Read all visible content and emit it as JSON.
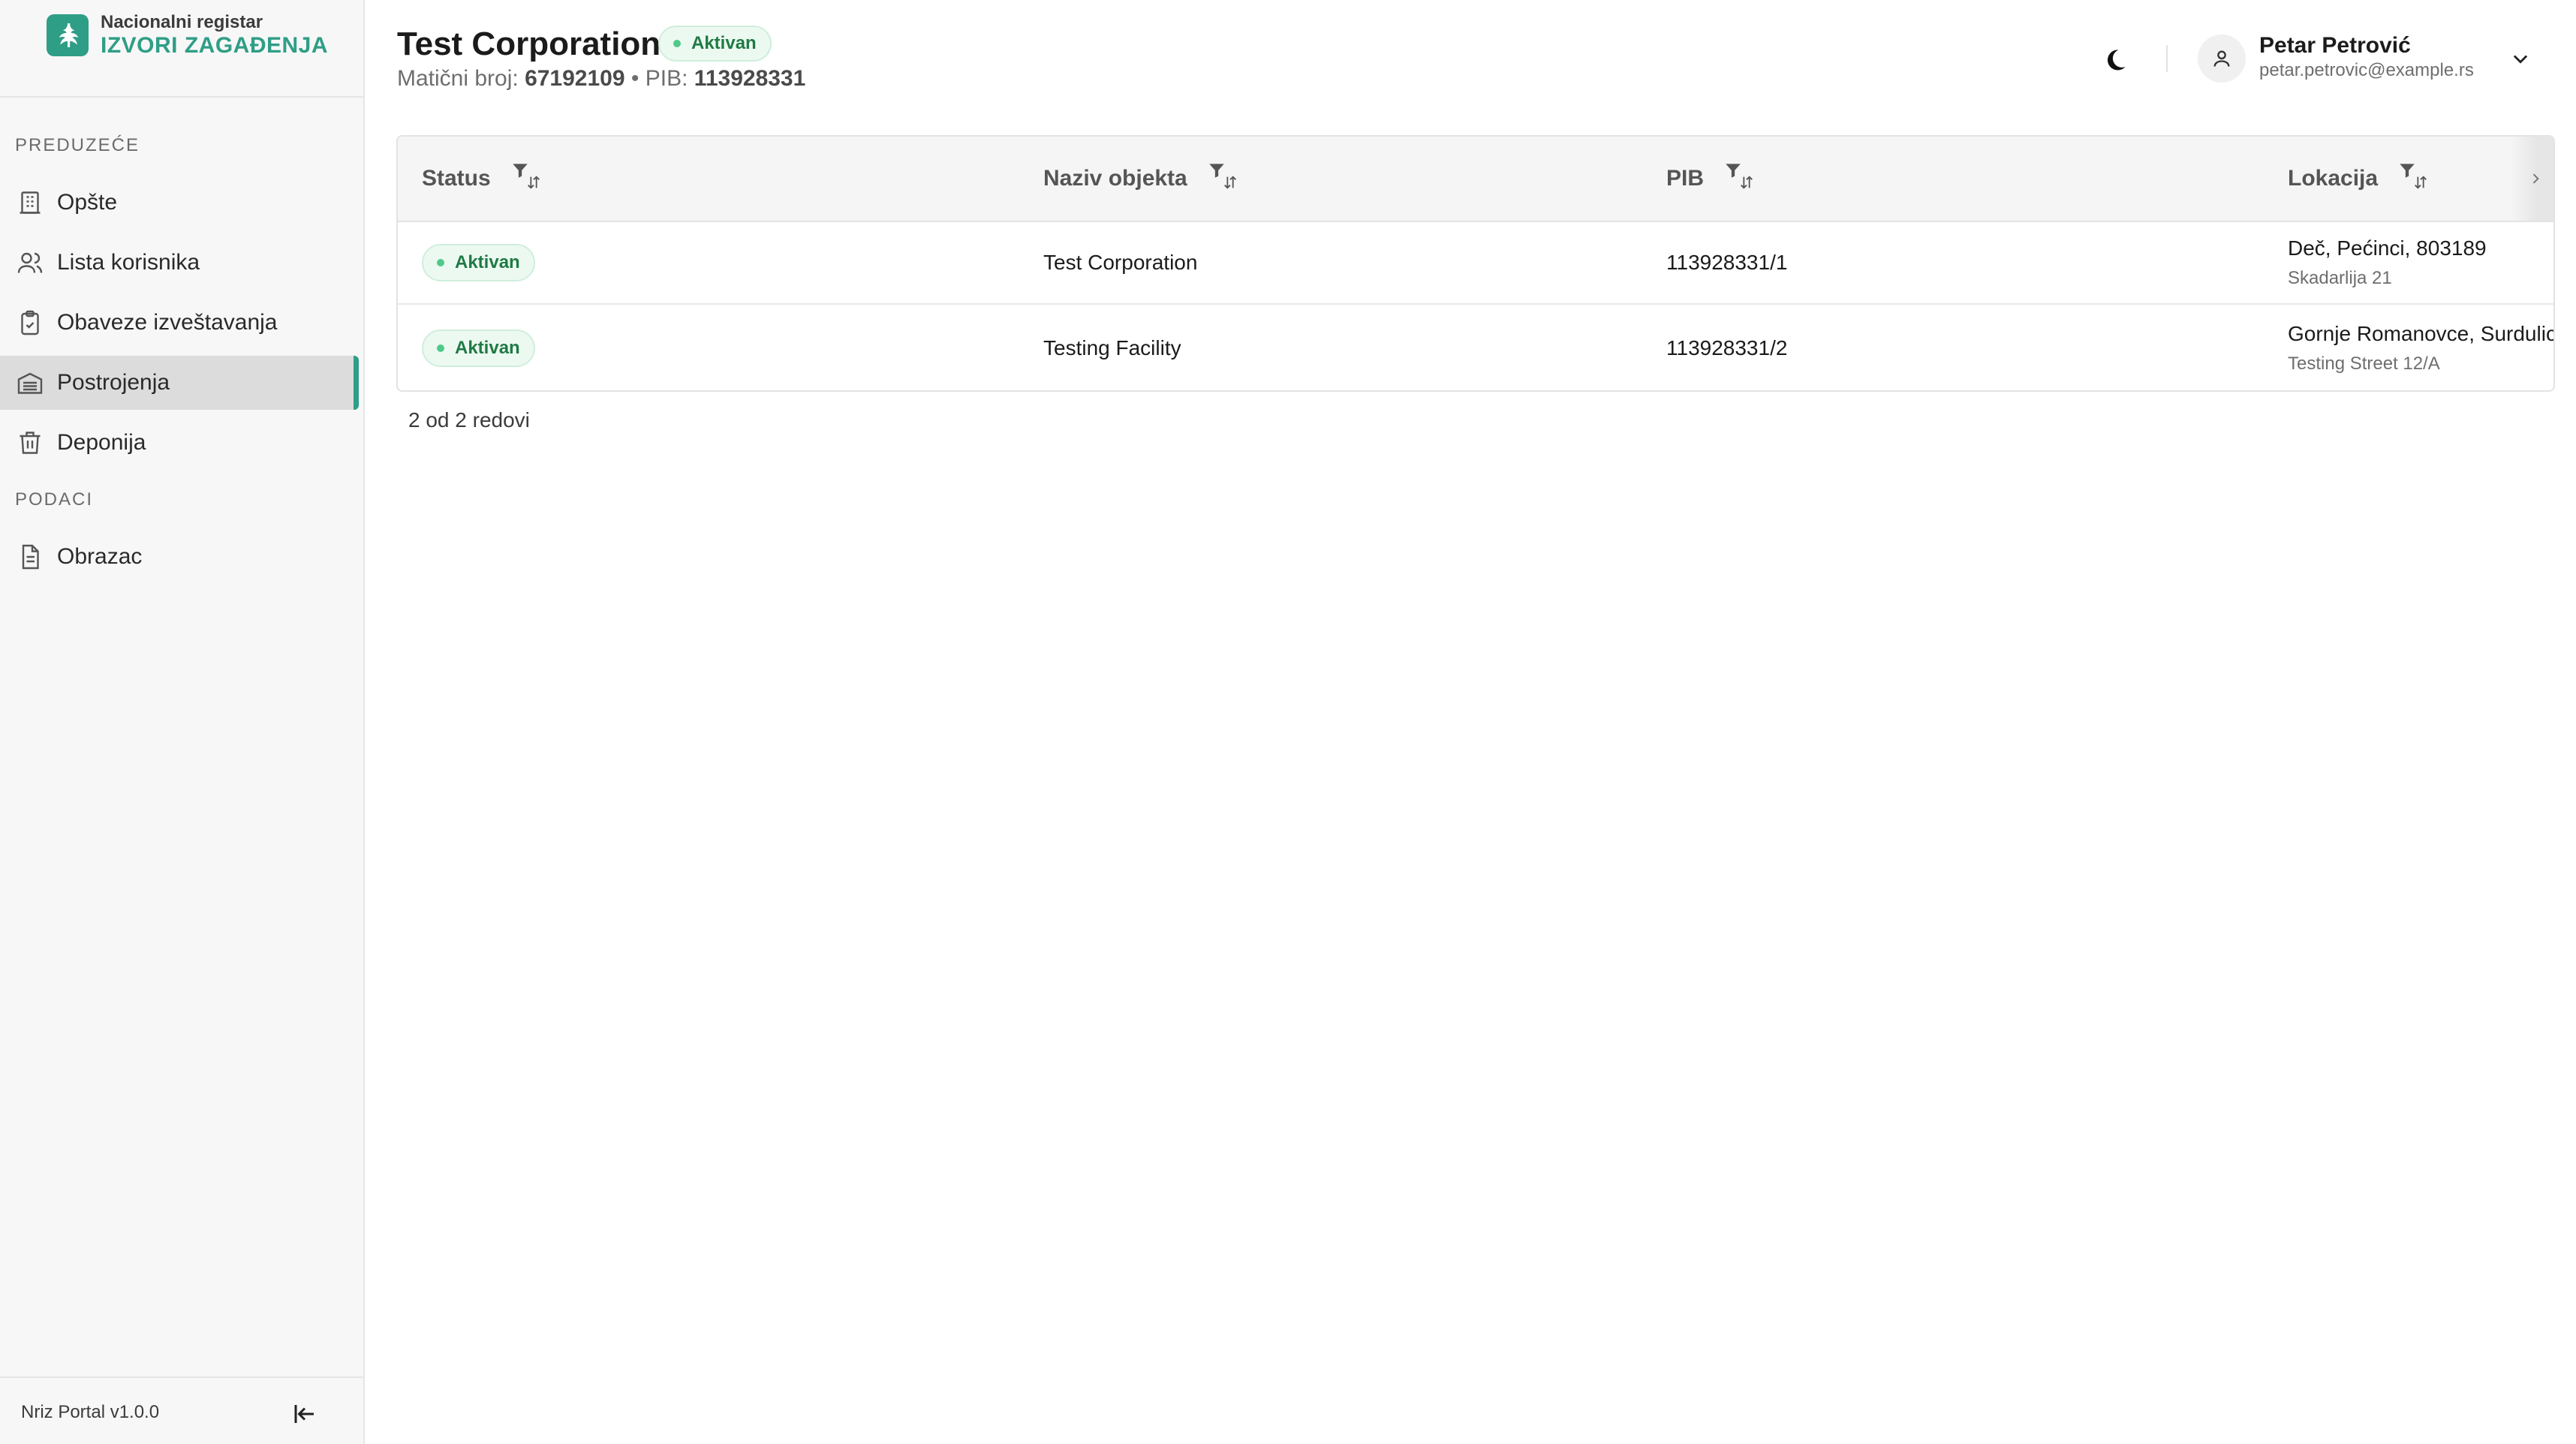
{
  "brand": {
    "line1": "Nacionalni registar",
    "line2": "IZVORI ZAGAĐENJA",
    "color": "#2f9e86"
  },
  "sidebar": {
    "sections": [
      {
        "label": "PREDUZEĆE"
      },
      {
        "label": "PODACI"
      }
    ],
    "items": [
      {
        "label": "Opšte",
        "icon": "building-icon",
        "active": false
      },
      {
        "label": "Lista korisnika",
        "icon": "users-icon",
        "active": false
      },
      {
        "label": "Obaveze izveštavanja",
        "icon": "clipboard-check-icon",
        "active": false
      },
      {
        "label": "Postrojenja",
        "icon": "warehouse-icon",
        "active": true
      },
      {
        "label": "Deponija",
        "icon": "trash-icon",
        "active": false
      },
      {
        "label": "Obrazac",
        "icon": "document-icon",
        "active": false
      }
    ],
    "version": "Nriz Portal v1.0.0"
  },
  "header": {
    "title": "Test Corporation",
    "status": "Aktivan",
    "mb_label": "Matični broj:",
    "mb_value": "67192109",
    "separator": "•",
    "pib_label": "PIB:",
    "pib_value": "113928331"
  },
  "user": {
    "name": "Petar Petrović",
    "email": "petar.petrovic@example.rs"
  },
  "table": {
    "columns": [
      "Status",
      "Naziv objekta",
      "PIB",
      "Lokacija"
    ],
    "rows": [
      {
        "status": "Aktivan",
        "name": "Test Corporation",
        "pib": "113928331/1",
        "location": "Deč, Pećinci, 803189",
        "address": "Skadarlija 21"
      },
      {
        "status": "Aktivan",
        "name": "Testing Facility",
        "pib": "113928331/2",
        "location": "Gornje Romanovce, Surdulica",
        "address": "Testing Street 12/A"
      }
    ],
    "row_count": "2 od 2 redovi"
  },
  "colors": {
    "accent": "#2f9e86",
    "badge_bg": "#ecf9f1",
    "badge_text": "#1f7a44",
    "badge_dot": "#4fc98a"
  }
}
